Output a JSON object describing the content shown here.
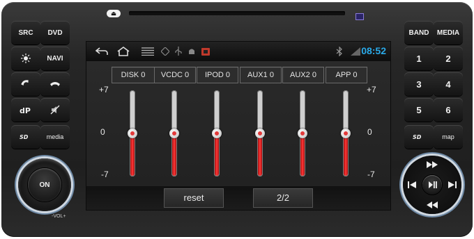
{
  "head_unit": {
    "left_buttons": {
      "src": "SRC",
      "dvd": "DVD",
      "navi": "NAVI",
      "media": "media"
    },
    "right_buttons": {
      "band": "BAND",
      "media": "MEDIA",
      "num1": "1",
      "num2": "2",
      "num3": "3",
      "num4": "4",
      "num5": "5",
      "num6": "6",
      "map": "map"
    },
    "knob": {
      "center": "ON",
      "label": "-VOL+"
    }
  },
  "status_bar": {
    "time": "08:52",
    "time_color": "#2aa9e8"
  },
  "equalizer": {
    "scale_top": "+7",
    "scale_mid": "0",
    "scale_bottom": "-7",
    "channels": [
      {
        "label": "DISK  0",
        "value": 0
      },
      {
        "label": "VCDC  0",
        "value": 0
      },
      {
        "label": "IPOD  0",
        "value": 0
      },
      {
        "label": "AUX1  0",
        "value": 0
      },
      {
        "label": "AUX2  0",
        "value": 0
      },
      {
        "label": "APP  0",
        "value": 0
      }
    ],
    "range": [
      -7,
      7
    ],
    "fill_color": "#e42b2b"
  },
  "bottom_bar": {
    "reset": "reset",
    "page": "2/2"
  }
}
